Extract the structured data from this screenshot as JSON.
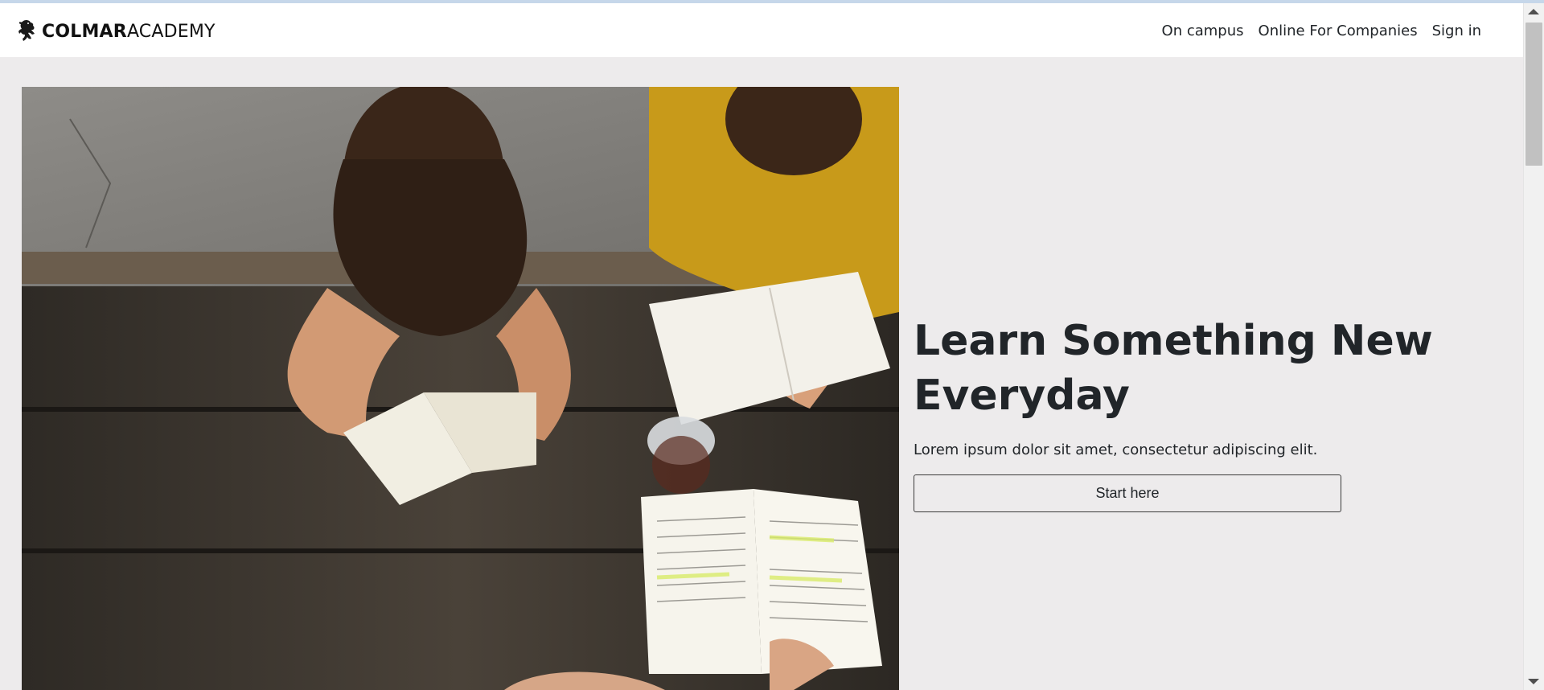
{
  "brand": {
    "name_bold": "COLMAR",
    "name_regular": "ACADEMY",
    "logo_icon": "lion-rampant-icon"
  },
  "nav": {
    "items": [
      {
        "label": "On campus"
      },
      {
        "label": "Online For Companies"
      },
      {
        "label": "Sign in"
      }
    ]
  },
  "hero": {
    "image_icon": "students-reading-photo",
    "headline": "Learn Something New Everyday",
    "subtext": "Lorem ipsum dolor sit amet, consectetur adipiscing elit.",
    "cta_label": "Start here"
  },
  "colors": {
    "page_background": "#edebec",
    "navbar_background": "#ffffff",
    "text": "#212529"
  }
}
